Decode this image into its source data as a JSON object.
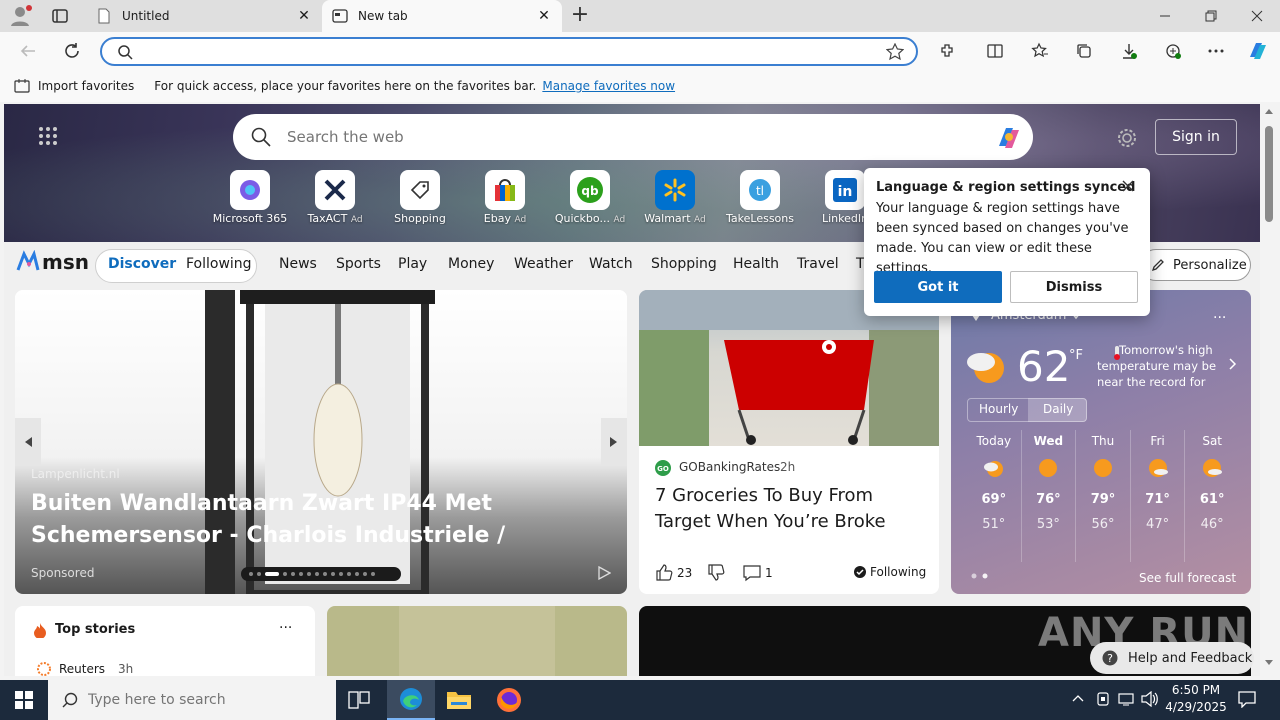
{
  "tabs": [
    {
      "label": "Untitled",
      "active": false
    },
    {
      "label": "New tab",
      "active": true
    }
  ],
  "address_bar": {
    "placeholder": ""
  },
  "favorites_bar": {
    "import_label": "Import favorites",
    "message": "For quick access, place your favorites here on the favorites bar.",
    "manage_link": "Manage favorites now"
  },
  "msn": {
    "search_placeholder": "Search the web",
    "sign_in": "Sign in",
    "quick_links": [
      {
        "name": "Microsoft 365",
        "ad": ""
      },
      {
        "name": "TaxACT",
        "ad": "Ad"
      },
      {
        "name": "Shopping",
        "ad": ""
      },
      {
        "name": "Ebay",
        "ad": "Ad"
      },
      {
        "name": "Quickbo...",
        "ad": "Ad"
      },
      {
        "name": "Walmart",
        "ad": "Ad"
      },
      {
        "name": "TakeLessons",
        "ad": ""
      },
      {
        "name": "LinkedIn",
        "ad": ""
      }
    ],
    "logo": "msn",
    "nav": {
      "discover": "Discover",
      "following": "Following",
      "items": [
        "News",
        "Sports",
        "Play",
        "Money",
        "Weather",
        "Watch",
        "Shopping",
        "Health",
        "Travel",
        "T"
      ],
      "personalize": "Personalize"
    },
    "hero": {
      "source": "Lampenlicht.nl",
      "title": "Buiten Wandlantaarn Zwart IP44 Met Schemersensor - Charlois Industriele / Industrie /...",
      "sponsored": "Sponsored"
    },
    "grocery": {
      "source": "GOBankingRates",
      "age": "2h",
      "title": "7 Groceries To Buy From Target When You’re Broke",
      "likes": "23",
      "comments": "1",
      "following": "Following"
    },
    "weather": {
      "location": "Amsterdam",
      "temp": "62",
      "unit": "°F",
      "note": "Tomorrow's high temperature may be near the record for A...",
      "tab_hourly": "Hourly",
      "tab_daily": "Daily",
      "days": [
        {
          "day": "Today",
          "high": "69°",
          "low": "51°"
        },
        {
          "day": "Wed",
          "high": "76°",
          "low": "53°"
        },
        {
          "day": "Thu",
          "high": "79°",
          "low": "56°"
        },
        {
          "day": "Fri",
          "high": "71°",
          "low": "47°"
        },
        {
          "day": "Sat",
          "high": "61°",
          "low": "46°"
        }
      ],
      "see_full": "See full forecast"
    },
    "top_stories": {
      "title": "Top stories",
      "source": "Reuters",
      "age": "3h"
    },
    "help": "Help and Feedback"
  },
  "popup": {
    "title": "Language & region settings synced",
    "body": "Your language & region settings have been synced based on changes you've made. You can view or edit these settings.",
    "got_it": "Got it",
    "dismiss": "Dismiss"
  },
  "taskbar": {
    "search_placeholder": "Type here to search",
    "time": "6:50 PM",
    "date": "4/29/2025"
  },
  "watermark": "ANY RUN"
}
